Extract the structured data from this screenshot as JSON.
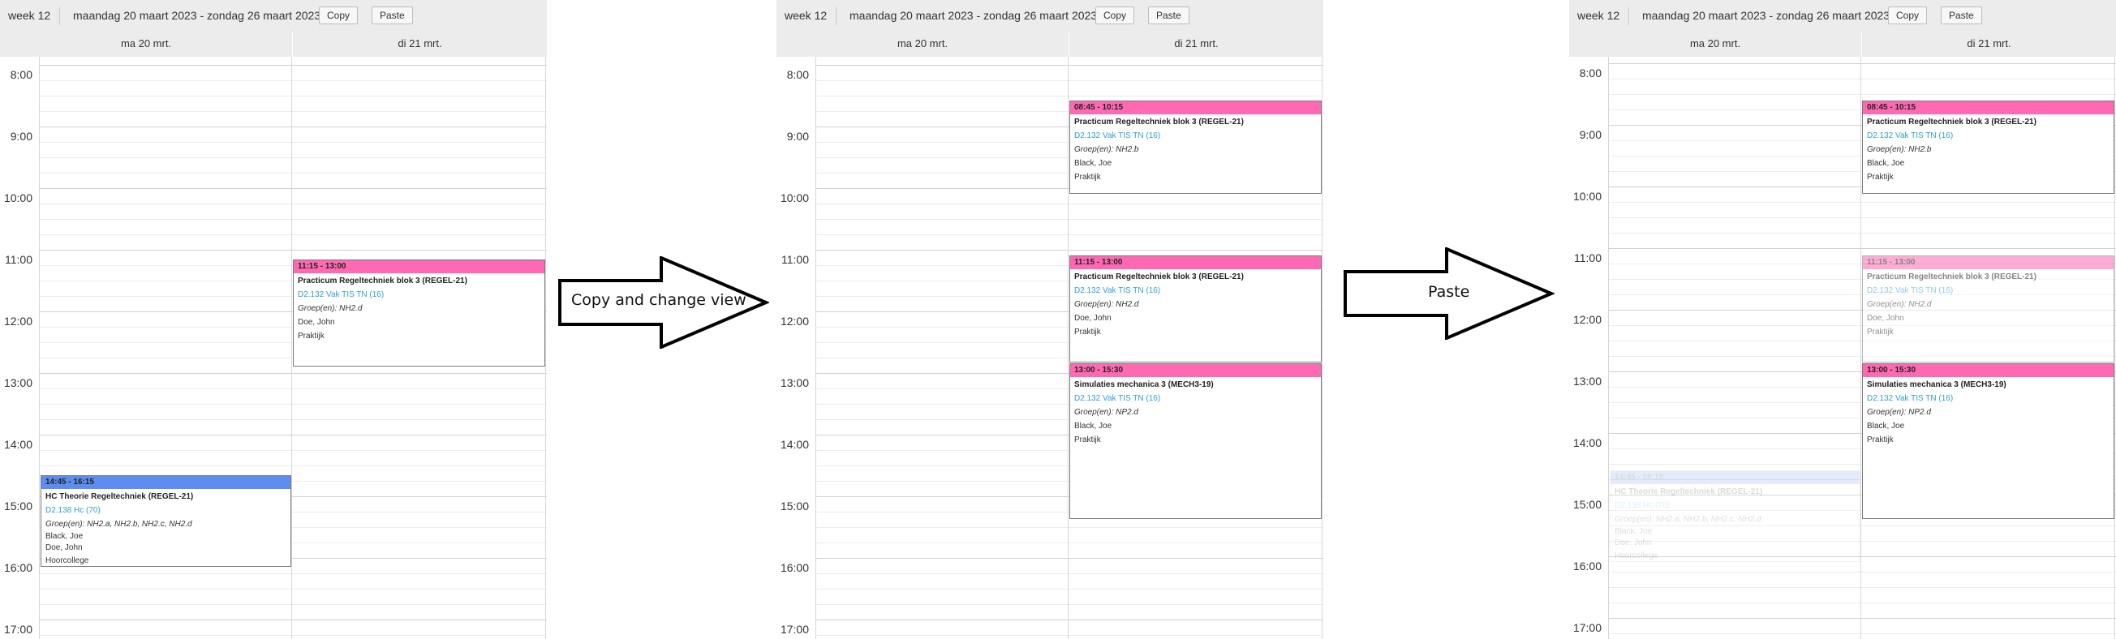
{
  "toolbar": {
    "week": "week 12",
    "range": "maandag 20 maart 2023 - zondag 26 maart 2023",
    "copy_label": "Copy",
    "paste_label": "Paste"
  },
  "days": {
    "mon": "ma 20 mrt.",
    "tue": "di 21 mrt."
  },
  "times": [
    "8:00",
    "9:00",
    "10:00",
    "11:00",
    "12:00",
    "13:00",
    "14:00",
    "15:00",
    "16:00",
    "17:00"
  ],
  "events": {
    "theory": {
      "time": "14:45 - 16:15",
      "title": "HC Theorie Regeltechniek (REGEL-21)",
      "room": "D2.138 Hc (70)",
      "groups": "Groep(en): NH2.a, NH2.b, NH2.c, NH2.d",
      "teacher1": "Black, Joe",
      "teacher2": "Doe, John",
      "type": "Hoorcollege"
    },
    "pract_d": {
      "time": "11:15 - 13:00",
      "title": "Practicum Regeltechniek blok 3 (REGEL-21)",
      "room": "D2.132 Vak TIS TN (16)",
      "groups": "Groep(en): NH2.d",
      "teacher": "Doe, John",
      "type": "Praktijk"
    },
    "pract_b": {
      "time": "08:45 - 10:15",
      "title": "Practicum Regeltechniek blok 3 (REGEL-21)",
      "room": "D2.132 Vak TIS TN (16)",
      "groups": "Groep(en): NH2.b",
      "teacher": "Black, Joe",
      "type": "Praktijk"
    },
    "sim": {
      "time": "13:00 - 15:30",
      "title": "Simulaties mechanica 3 (MECH3-19)",
      "room": "D2.132 Vak TIS TN (16)",
      "groups": "Groep(en): NP2.d",
      "teacher": "Black, Joe",
      "type": "Praktijk"
    }
  },
  "arrows": {
    "first": "Copy and change view",
    "second": "Paste"
  },
  "colors": {
    "pink": "#ff69b4",
    "blue": "#5b8ef0",
    "room": "#2e9fd8"
  }
}
